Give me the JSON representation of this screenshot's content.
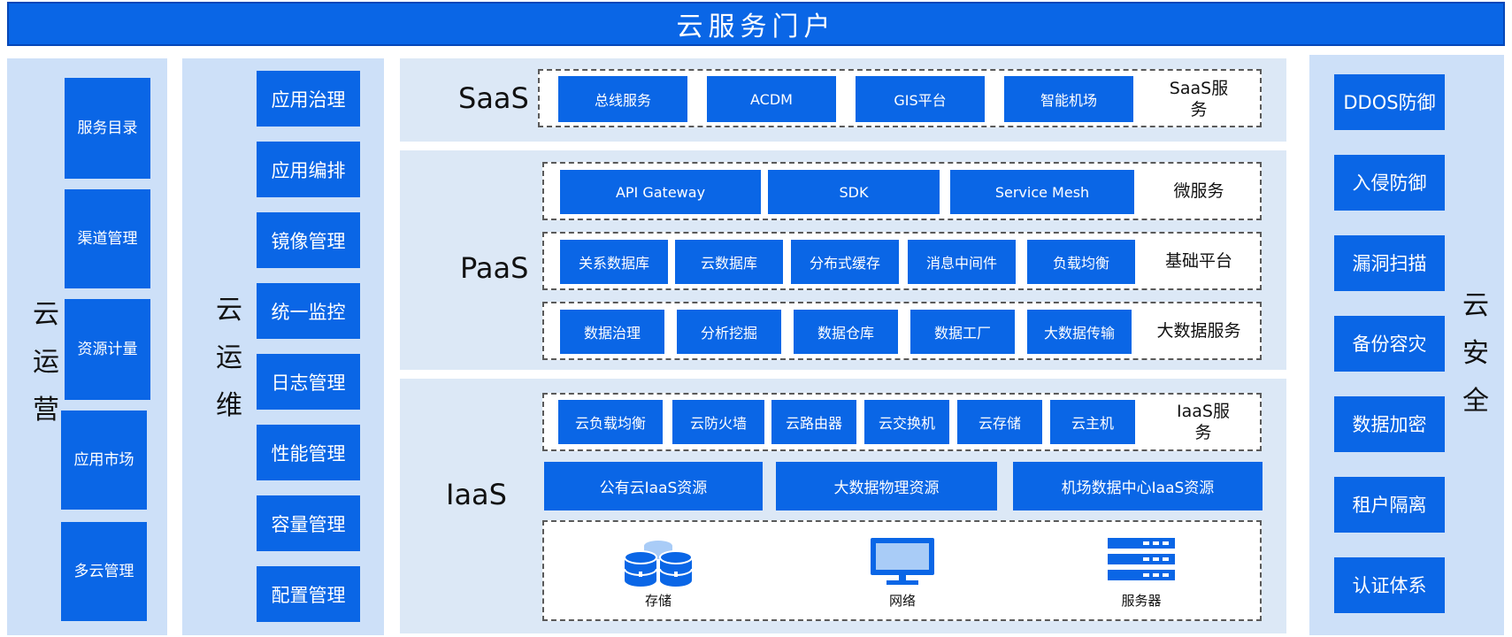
{
  "banner": "云服务门户",
  "left_ops": {
    "title_chars": [
      "云",
      "运",
      "营"
    ],
    "items": [
      "服务目录",
      "渠道管理",
      "资源计量",
      "应用市场",
      "多云管理"
    ]
  },
  "left_maint": {
    "title_chars": [
      "云",
      "运",
      "维"
    ],
    "items": [
      "应用治理",
      "应用编排",
      "镜像管理",
      "统一监控",
      "日志管理",
      "性能管理",
      "容量管理",
      "配置管理"
    ]
  },
  "saas": {
    "title": "SaaS",
    "label": "SaaS服务",
    "cells": [
      "智能机场",
      "GIS平台",
      "ACDM",
      "总线服务"
    ]
  },
  "paas": {
    "title": "PaaS",
    "rows": [
      {
        "label": "微服务",
        "cells": [
          "Service Mesh",
          "SDK",
          "API Gateway"
        ]
      },
      {
        "label": "基础平台",
        "cells": [
          "负载均衡",
          "消息中间件",
          "分布式缓存",
          "云数据库",
          "关系数据库"
        ]
      },
      {
        "label": "大数据服务",
        "cells": [
          "大数据传输",
          "数据工厂",
          "数据仓库",
          "分析挖掘",
          "数据治理"
        ]
      }
    ]
  },
  "iaas": {
    "title": "IaaS",
    "service_label": "IaaS服务",
    "cells": [
      "云主机",
      "云存储",
      "云交换机",
      "云路由器",
      "云防火墙",
      "云负载均衡"
    ],
    "resources": [
      "机场数据中心IaaS资源",
      "大数据物理资源",
      "公有云IaaS资源"
    ],
    "hardware": [
      {
        "icon": "server-rack-icon",
        "label": "服务器"
      },
      {
        "icon": "monitor-icon",
        "label": "网络"
      },
      {
        "icon": "storage-icon",
        "label": "存储"
      }
    ]
  },
  "security": {
    "title_chars": [
      "云",
      "安",
      "全"
    ],
    "items": [
      "DDOS防御",
      "入侵防御",
      "漏洞扫描",
      "备份容灾",
      "数据加密",
      "租户隔离",
      "认证体系"
    ]
  },
  "colors": {
    "accent": "#0a66e6",
    "panel": "#cde0f8",
    "panel_mid": "#dce8f6"
  }
}
